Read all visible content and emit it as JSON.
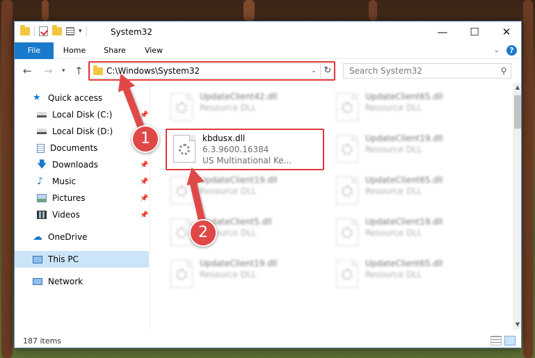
{
  "window": {
    "title": "System32",
    "minimize_icon": "minimize-icon",
    "maximize_icon": "maximize-icon",
    "close_icon": "close-icon"
  },
  "ribbon": {
    "tabs": [
      "File",
      "Home",
      "Share",
      "View"
    ],
    "help_label": "?"
  },
  "address": {
    "path": "C:\\Windows\\System32",
    "search_placeholder": "Search System32"
  },
  "nav_pane": {
    "items": [
      {
        "label": "Quick access",
        "icon": "star-icon",
        "pinned": false
      },
      {
        "label": "Local Disk (C:)",
        "icon": "drive-icon",
        "pinned": true
      },
      {
        "label": "Local Disk (D:)",
        "icon": "drive-icon",
        "pinned": true
      },
      {
        "label": "Documents",
        "icon": "document-icon",
        "pinned": true
      },
      {
        "label": "Downloads",
        "icon": "download-icon",
        "pinned": true
      },
      {
        "label": "Music",
        "icon": "music-icon",
        "pinned": true
      },
      {
        "label": "Pictures",
        "icon": "pictures-icon",
        "pinned": true
      },
      {
        "label": "Videos",
        "icon": "videos-icon",
        "pinned": true
      },
      {
        "label": "OneDrive",
        "icon": "cloud-icon",
        "pinned": false
      },
      {
        "label": "This PC",
        "icon": "computer-icon",
        "pinned": false,
        "selected": true
      },
      {
        "label": "Network",
        "icon": "network-icon",
        "pinned": false
      }
    ]
  },
  "files": {
    "left_column": [
      {
        "name": "UpdateClient42.dll",
        "sub1": "Resource DLL",
        "sub2": "",
        "blurred": true
      },
      {
        "name": "kbdusx.dll",
        "sub1": "6.3.9600.16384",
        "sub2": "US Multinational Ke...",
        "blurred": false
      },
      {
        "name": "UpdateClient19.dll",
        "sub1": "Resource DLL",
        "sub2": "",
        "blurred": true
      },
      {
        "name": "UpdateClient5.dll",
        "sub1": "Resource DLL",
        "sub2": "",
        "blurred": true
      },
      {
        "name": "UpdateClient19.dll",
        "sub1": "Resource DLL",
        "sub2": "",
        "blurred": true
      }
    ],
    "right_column": [
      {
        "name": "UpdateClient65.dll",
        "sub1": "Resource DLL",
        "sub2": "",
        "blurred": true
      },
      {
        "name": "UpdateClient19.dll",
        "sub1": "Resource DLL",
        "sub2": "",
        "blurred": true
      },
      {
        "name": "UpdateClient65.dll",
        "sub1": "Resource DLL",
        "sub2": "",
        "blurred": true
      },
      {
        "name": "UpdateClient19.dll",
        "sub1": "Resource DLL",
        "sub2": "",
        "blurred": true
      },
      {
        "name": "UpdateClient65.dll",
        "sub1": "Resource DLL",
        "sub2": "",
        "blurred": true
      }
    ]
  },
  "status": {
    "item_count": "187 items"
  },
  "callouts": [
    {
      "number": "1"
    },
    {
      "number": "2"
    }
  ],
  "colors": {
    "accent": "#1979ca",
    "highlight": "#e03636",
    "callout": "#e04848",
    "selected_nav": "#cce4f7"
  }
}
